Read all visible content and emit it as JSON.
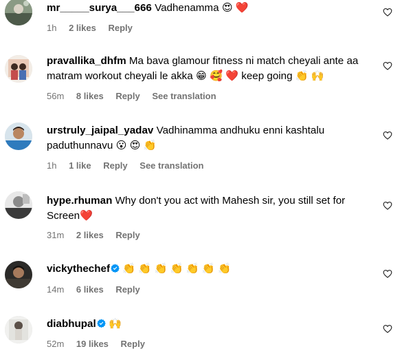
{
  "comments": [
    {
      "username": "mr_____surya___666",
      "text": " Vadhenamma 😍 ❤️",
      "time": "1h",
      "likes": "2 likes",
      "reply": "Reply",
      "translation": "",
      "verified": false
    },
    {
      "username": "pravallika_dhfm",
      "text": " Ma bava glamour fitness ni match cheyali ante aa matram workout cheyali le akka 😁 🥰 ❤️ keep going 👏 🙌",
      "time": "56m",
      "likes": "8 likes",
      "reply": "Reply",
      "translation": "See translation",
      "verified": false
    },
    {
      "username": "urstruly_jaipal_yadav",
      "text": " Vadhinamma andhuku enni kashtalu paduthunnavu 😮 😍 👏",
      "time": "1h",
      "likes": "1 like",
      "reply": "Reply",
      "translation": "See translation",
      "verified": false
    },
    {
      "username": "hype.rhuman",
      "text": " Why don't you act with Mahesh sir, you still set for Screen❤️",
      "time": "31m",
      "likes": "2 likes",
      "reply": "Reply",
      "translation": "",
      "verified": false
    },
    {
      "username": "vickythechef",
      "text": " 👏 👏 👏 👏 👏 👏 👏",
      "time": "14m",
      "likes": "6 likes",
      "reply": "Reply",
      "translation": "",
      "verified": true
    },
    {
      "username": "diabhupal",
      "text": " 🙌",
      "time": "52m",
      "likes": "19 likes",
      "reply": "Reply",
      "translation": "",
      "verified": true
    }
  ],
  "icons": {
    "like": "heart-outline-icon",
    "verified": "verified-badge-icon"
  },
  "colors": {
    "text": "#000000",
    "meta": "#737373",
    "verified": "#0095f6"
  }
}
